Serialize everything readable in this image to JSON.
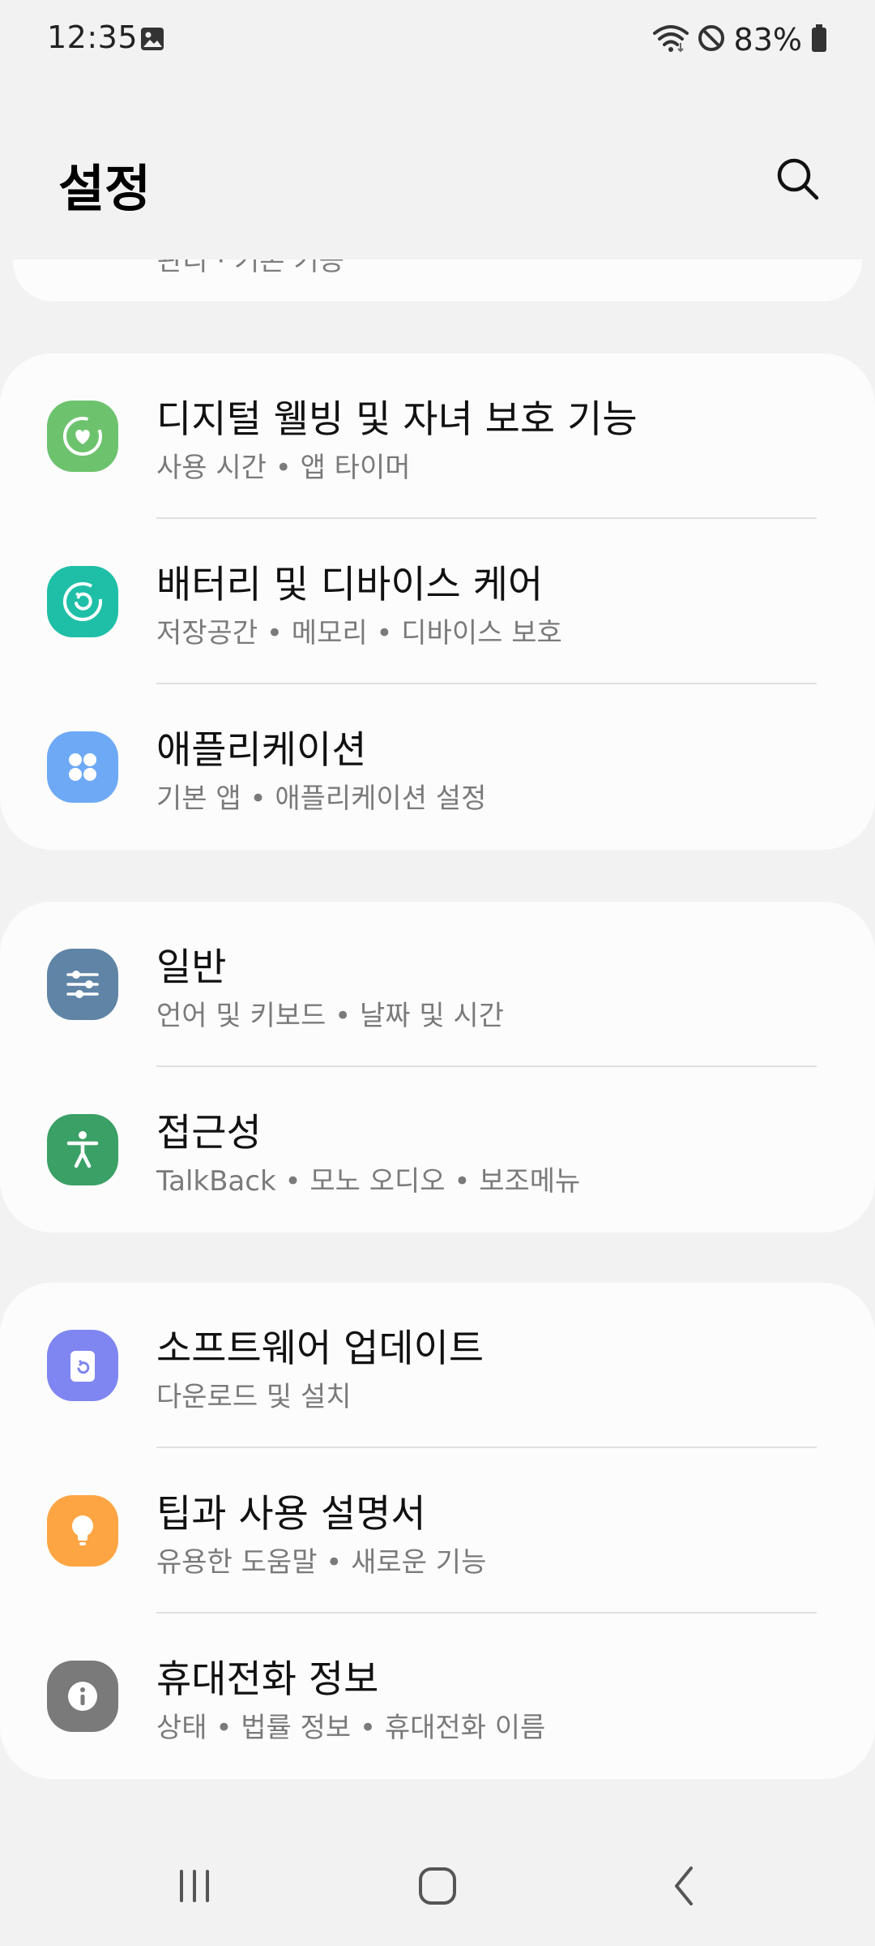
{
  "status_bar": {
    "time": "12:35",
    "battery": "83%",
    "icons": [
      "gallery-icon",
      "wifi-icon",
      "do-not-disturb-icon",
      "battery-icon"
    ]
  },
  "header": {
    "title": "설정",
    "search_icon": "search-icon"
  },
  "partial_item": {
    "subtitle": "관리     · 기본 기능"
  },
  "groups": [
    {
      "items": [
        {
          "title": "디지털 웰빙 및 자녀 보호 기능",
          "subtitle": "사용 시간  •  앱 타이머",
          "icon": "digital-wellbeing-icon",
          "color": "#6dc36d"
        },
        {
          "title": "배터리 및 디바이스 케어",
          "subtitle": "저장공간  •  메모리  •  디바이스 보호",
          "icon": "device-care-icon",
          "color": "#1fbfa7"
        },
        {
          "title": "애플리케이션",
          "subtitle": "기본 앱  •  애플리케이션 설정",
          "icon": "apps-icon",
          "color": "#6ea9f6"
        }
      ]
    },
    {
      "items": [
        {
          "title": "일반",
          "subtitle": "언어 및 키보드  •  날짜 및 시간",
          "icon": "general-management-icon",
          "color": "#5f84a6"
        },
        {
          "title": "접근성",
          "subtitle": "TalkBack  •  모노 오디오  •  보조메뉴",
          "icon": "accessibility-icon",
          "color": "#3aa065"
        }
      ]
    },
    {
      "items": [
        {
          "title": "소프트웨어 업데이트",
          "subtitle": "다운로드 및 설치",
          "icon": "software-update-icon",
          "color": "#7f86f1"
        },
        {
          "title": "팁과 사용 설명서",
          "subtitle": "유용한 도움말  •  새로운 기능",
          "icon": "tips-icon",
          "color": "#fda543"
        },
        {
          "title": "휴대전화 정보",
          "subtitle": "상태  •  법률 정보  •  휴대전화 이름",
          "icon": "about-phone-icon",
          "color": "#7a7a7a"
        }
      ]
    }
  ],
  "nav_bar": {
    "icons": [
      "recent-apps-icon",
      "home-icon",
      "back-icon"
    ]
  }
}
